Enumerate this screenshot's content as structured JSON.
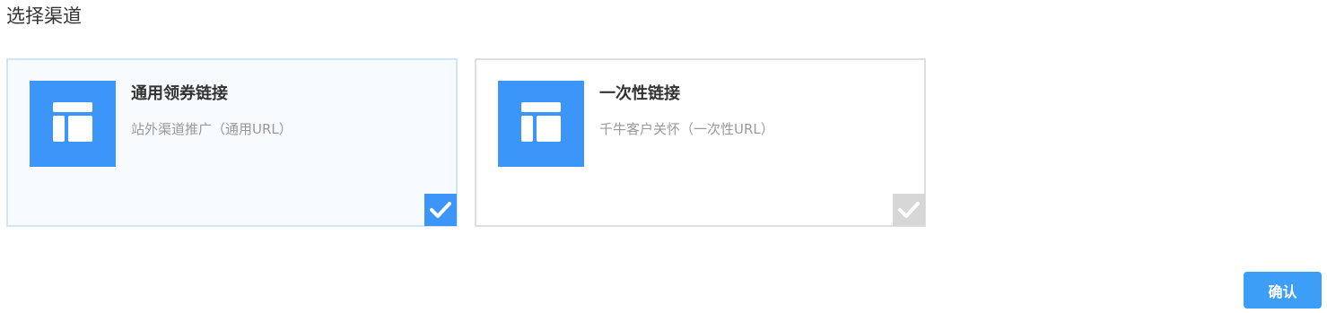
{
  "page": {
    "title": "选择渠道"
  },
  "channels": [
    {
      "title": "通用领券链接",
      "description": "站外渠道推广（通用URL）",
      "icon": "layout-template-icon",
      "selected": true
    },
    {
      "title": "一次性链接",
      "description": "千牛客户关怀（一次性URL）",
      "icon": "layout-template-icon",
      "selected": false
    }
  ],
  "actions": {
    "confirm_label": "确认"
  },
  "colors": {
    "accent": "#3c95f8",
    "selected_card_bg": "#f8fbfe",
    "selected_card_border": "#cfe6f8",
    "card_border": "#dcdfe3",
    "check_inactive": "#d7d7d7",
    "button": "#3c9ef7"
  }
}
